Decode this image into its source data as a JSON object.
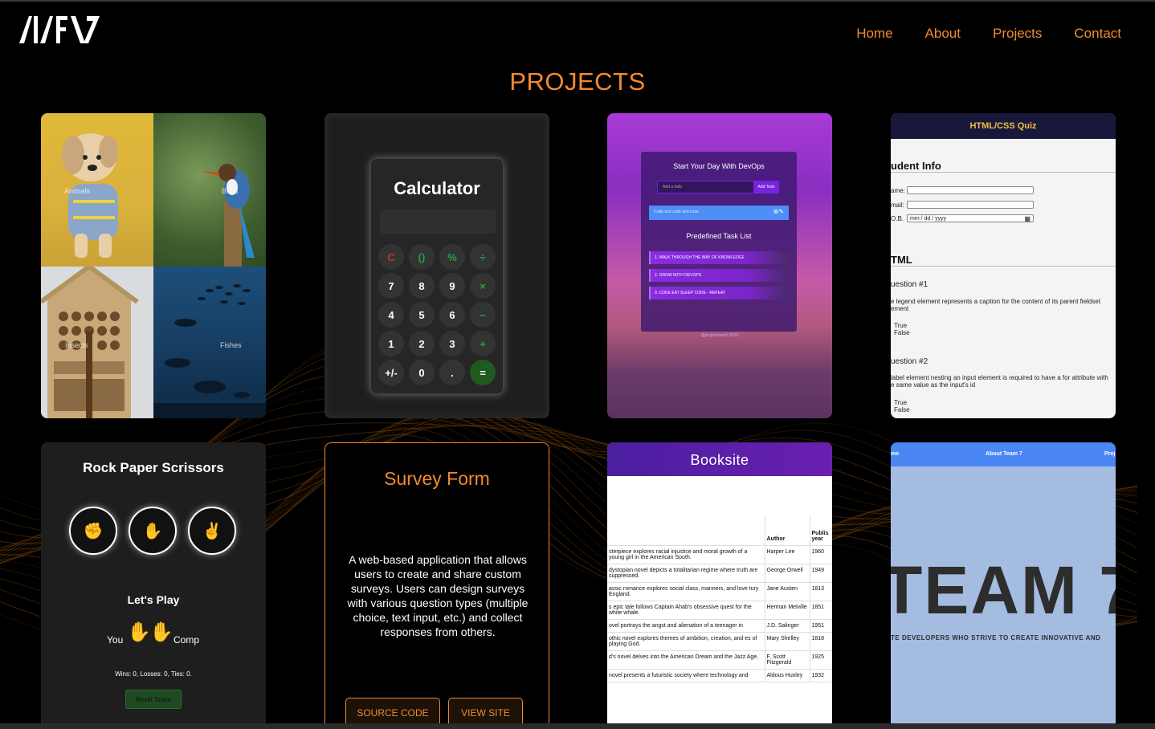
{
  "nav": {
    "home": "Home",
    "about": "About",
    "projects": "Projects",
    "contact": "Contact"
  },
  "page_title": "PROJECTS",
  "gallery": {
    "animals": "Animals",
    "birds": "Birds",
    "insects": "Insects",
    "fishes": "Fishes"
  },
  "calculator": {
    "title": "Calculator",
    "keys": [
      "C",
      "()",
      "%",
      "÷",
      "7",
      "8",
      "9",
      "×",
      "4",
      "5",
      "6",
      "−",
      "1",
      "2",
      "3",
      "+",
      "+/-",
      "0",
      ".",
      "="
    ]
  },
  "devops": {
    "title": "Start Your Day With DevOps",
    "input_placeholder": "Add a todo",
    "add_button": "Add Todo",
    "active_todo": "Code and code and code",
    "list_title": "Predefined Task List",
    "tasks": [
      "1. WALK THROUGH THE WAY OF KNOWLEDGE",
      "2. GROW WITH DEVOPS",
      "3. CODE EAT SLEEP CODE - REPEAT"
    ],
    "footer": "@projectteam1-2022"
  },
  "quiz": {
    "title": "HTML/CSS Quiz",
    "student_info": "udent Info",
    "name_label": "ame:",
    "email_label": "mail:",
    "dob_label": "O.B.",
    "dob_placeholder": "mm / dd / yyyy",
    "section": "TML",
    "q1": "uestion #1",
    "q1_text_1": "e legend element represents a caption for the content of its parent fieldset",
    "q1_text_2": "ement",
    "q2": "uestion #2",
    "q2_text_1": "label element nesting an input element is required to have a for attribute with",
    "q2_text_2": "e same value as the input's id",
    "true": "True",
    "false": "False"
  },
  "rps": {
    "title": "Rock Paper Scrissors",
    "lets_play": "Let's Play",
    "you": "You",
    "comp": "Comp",
    "score": "Wins: 0, Losses: 0, Ties: 0.",
    "reset": "Reset Score"
  },
  "survey": {
    "title": "Survey Form",
    "description": "A web-based application that allows users to create and share custom surveys. Users can design surveys with various question types (multiple choice, text input, etc.) and collect responses from others.",
    "source_code": "SOURCE CODE",
    "view_site": "VIEW SITE"
  },
  "booksite": {
    "title": "Booksite",
    "headers": [
      "",
      "Author",
      "Publis year"
    ],
    "rows": [
      [
        "sterpiece explores racial injustice and moral growth of a young girl in the American South.",
        "Harper Lee",
        "1960"
      ],
      [
        "dystopian novel depicts a totalitarian regime where truth are suppressed.",
        "George Orwell",
        "1949"
      ],
      [
        "assic romance explores social class, manners, and love tury England.",
        "Jane Austen",
        "1813"
      ],
      [
        "s epic tale follows Captain Ahab's obsessive quest for the white whale.",
        "Herman Melville",
        "1851"
      ],
      [
        "ovel portrays the angst and alienation of a teenager in",
        "J.D. Salinger",
        "1951"
      ],
      [
        "othic novel explores themes of ambition, creation, and es of playing God.",
        "Mary Shelley",
        "1818"
      ],
      [
        "d's novel delves into the American Dream and the Jazz Age.",
        "F. Scott Fitzgerald",
        "1925"
      ],
      [
        "novel presents a futuristic society where technology and",
        "Aldous Huxley",
        "1932"
      ]
    ]
  },
  "team": {
    "nav_left": "me",
    "nav_center": "About Team 7",
    "nav_right": "Proj",
    "big_text": "TEAM 7",
    "sub_text": "TE DEVELOPERS WHO STRIVE TO CREATE INNOVATIVE AND"
  },
  "colors": {
    "accent": "#f28a2f",
    "background": "#000000",
    "team_bg": "#a4bce0",
    "booksite_purple": "#5a1fa8"
  }
}
